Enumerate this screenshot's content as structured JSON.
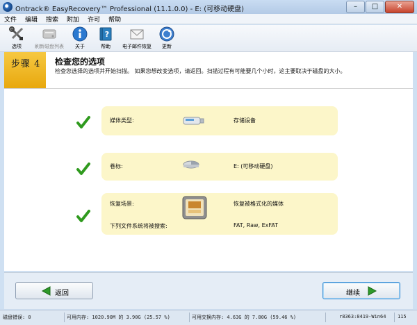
{
  "window": {
    "title": "Ontrack® EasyRecovery™ Professional (11.1.0.0) - E: (可移动硬盘)",
    "minimize": "–",
    "maximize": "□",
    "close": "✕"
  },
  "menu": [
    "文件",
    "编辑",
    "搜索",
    "附加",
    "许可",
    "帮助"
  ],
  "toolbar": [
    {
      "label": "选项",
      "icon": "tools-icon"
    },
    {
      "label": "刷新磁盘列表",
      "icon": "drive-refresh-icon",
      "disabled": true
    },
    {
      "label": "关于",
      "icon": "info-icon"
    },
    {
      "label": "帮助",
      "icon": "help-book-icon"
    },
    {
      "label": "电子邮件恢复",
      "icon": "email-icon"
    },
    {
      "label": "更新",
      "icon": "update-icon"
    }
  ],
  "step": {
    "badge": "步骤 4",
    "title": "检查您的选项",
    "description": "检查您选择的选项并开始扫描。 如果您想改变选项，请返回。扫描过程有可能要几个小时，这主要取决于磁盘的大小。"
  },
  "options": {
    "media": {
      "label": "媒体类型:",
      "value": "存储设备"
    },
    "volume": {
      "label": "卷标:",
      "value": "E: (可移动硬盘)"
    },
    "scenario": {
      "label": "恢复场景:",
      "value": "恢复被格式化的媒体"
    },
    "filesystems": {
      "label": "下列文件系统将被搜索:",
      "value": "FAT, Raw, ExFAT"
    }
  },
  "nav": {
    "back": "返回",
    "next": "继续"
  },
  "status": {
    "disk_errors": "磁盘错误: 0",
    "available_memory": "可用内存: 1020.90M 的 3.90G (25.57 %)",
    "swap_memory": "可用交换内存: 4.63G 的 7.80G (59.46 %)",
    "build": "r8363:8419-Win64",
    "code": "115"
  },
  "colors": {
    "accent": "#e8a80d",
    "check": "#2f9a1e",
    "row_bg": "#fcf6c9"
  }
}
